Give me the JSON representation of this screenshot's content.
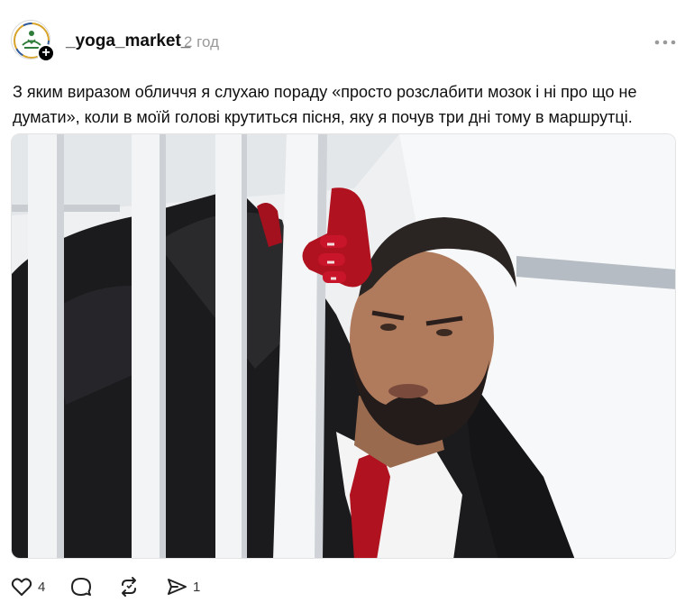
{
  "post": {
    "username": "_yoga_market_",
    "time": "2 год",
    "caption": "З яким виразом обличчя я слухаю пораду «просто розслабити мозок і ні про що не думати», коли в моїй голові крутиться пісня, яку я почув три дні тому в маршрутці.",
    "follow_symbol": "+",
    "media": {
      "description_icon": "photo-man-behind-bars"
    }
  },
  "actions": {
    "like": {
      "icon": "heart-icon",
      "count": "4"
    },
    "comment": {
      "icon": "comment-icon"
    },
    "repost": {
      "icon": "repost-icon"
    },
    "share": {
      "icon": "share-icon",
      "count": "1"
    }
  },
  "colors": {
    "accent_gold": "#d8a32a",
    "text": "#101010",
    "muted": "#999999"
  }
}
